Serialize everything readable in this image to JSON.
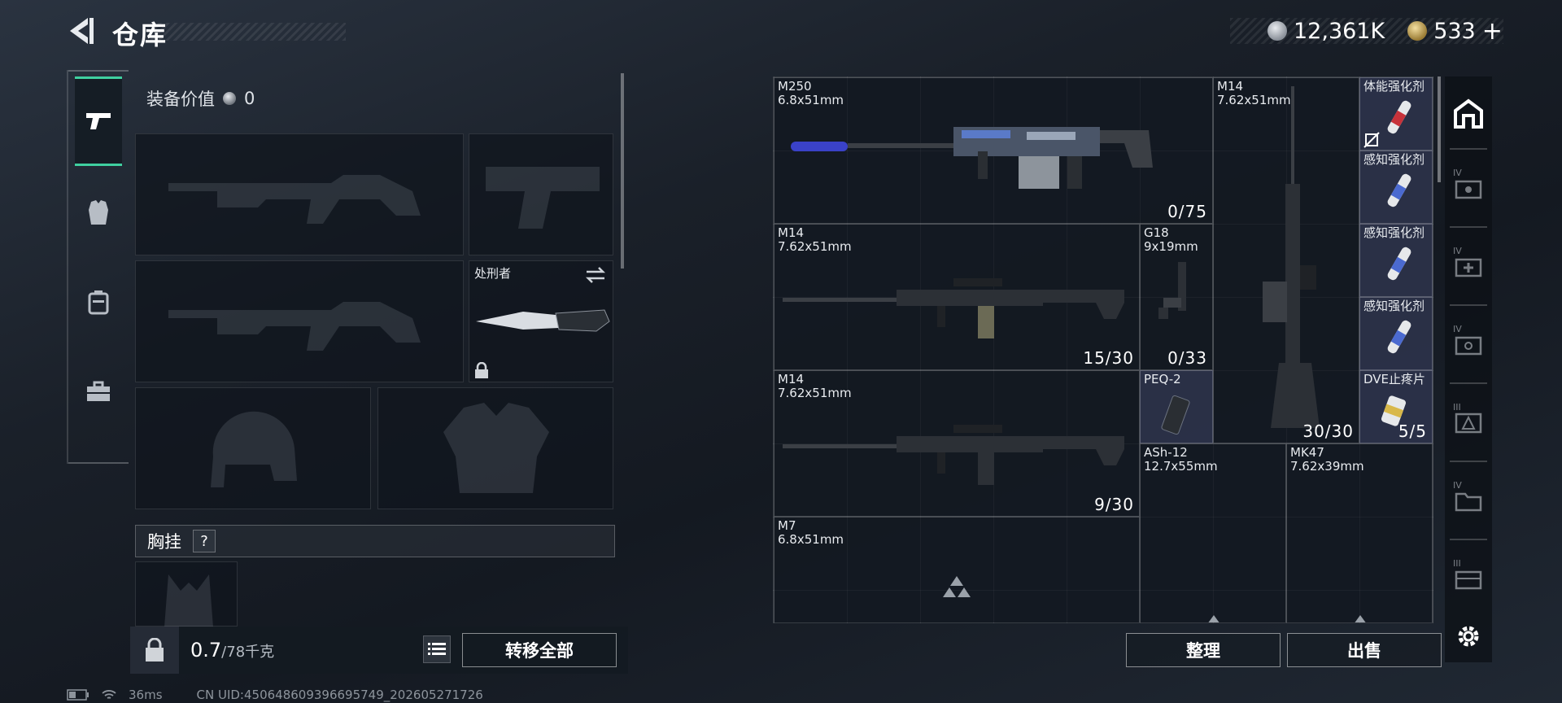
{
  "header": {
    "title": "仓库"
  },
  "currency": {
    "silver": "12,361K",
    "gold": "533",
    "gold_add": "+"
  },
  "equipment": {
    "value_label": "装备价值",
    "value": "0",
    "melee_slot_name": "处刑者",
    "chest_label": "胸挂",
    "help_label": "?"
  },
  "weight": {
    "current": "0.7",
    "capacity": "/78千克"
  },
  "buttons": {
    "transfer_all": "转移全部",
    "organize": "整理",
    "sell": "出售"
  },
  "inventory": {
    "items": [
      {
        "name": "M250",
        "caliber": "6.8x51mm",
        "count": "0/75"
      },
      {
        "name": "M14",
        "caliber": "7.62x51mm",
        "count": "30/30"
      },
      {
        "name": "体能强化剂",
        "caliber": "",
        "count": ""
      },
      {
        "name": "感知强化剂",
        "caliber": "",
        "count": ""
      },
      {
        "name": "感知强化剂",
        "caliber": "",
        "count": ""
      },
      {
        "name": "感知强化剂",
        "caliber": "",
        "count": ""
      },
      {
        "name": "M14",
        "caliber": "7.62x51mm",
        "count": "15/30"
      },
      {
        "name": "G18",
        "caliber": "9x19mm",
        "count": "0/33"
      },
      {
        "name": "M14",
        "caliber": "7.62x51mm",
        "count": "9/30"
      },
      {
        "name": "PEQ-2",
        "caliber": "",
        "count": ""
      },
      {
        "name": "DVE止疼片",
        "caliber": "",
        "count": "5/5"
      },
      {
        "name": "ASh-12",
        "caliber": "12.7x55mm",
        "count": ""
      },
      {
        "name": "MK47",
        "caliber": "7.62x39mm",
        "count": ""
      },
      {
        "name": "M7",
        "caliber": "6.8x51mm",
        "count": ""
      }
    ]
  },
  "right_nav": {
    "levels": [
      "IV",
      "IV",
      "IV",
      "III",
      "IV",
      "III"
    ]
  },
  "status": {
    "ping": "36ms",
    "uid": "CN UID:450648609396695749_202605271726"
  },
  "colors": {
    "accent": "#3fd0a0",
    "item_blue": "#3c4264"
  }
}
